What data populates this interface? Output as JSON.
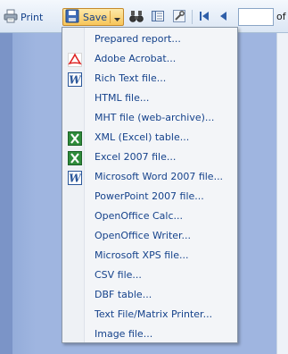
{
  "toolbar": {
    "print_label": "Print",
    "save_label": "Save",
    "page_input_value": "",
    "of_label": "of"
  },
  "menu": {
    "items": [
      {
        "label": "Prepared report...",
        "icon": ""
      },
      {
        "label": "Adobe Acrobat...",
        "icon": "pdf-icon"
      },
      {
        "label": "Rich Text file...",
        "icon": "word-icon"
      },
      {
        "label": "HTML file...",
        "icon": ""
      },
      {
        "label": "MHT file (web-archive)...",
        "icon": ""
      },
      {
        "label": "XML (Excel) table...",
        "icon": "excel-icon"
      },
      {
        "label": "Excel 2007 file...",
        "icon": "excel-icon"
      },
      {
        "label": "Microsoft Word 2007 file...",
        "icon": "word-icon"
      },
      {
        "label": "PowerPoint 2007 file...",
        "icon": ""
      },
      {
        "label": "OpenOffice Calc...",
        "icon": ""
      },
      {
        "label": "OpenOffice Writer...",
        "icon": ""
      },
      {
        "label": "Microsoft XPS file...",
        "icon": ""
      },
      {
        "label": "CSV file...",
        "icon": ""
      },
      {
        "label": "DBF table...",
        "icon": ""
      },
      {
        "label": "Text File/Matrix Printer...",
        "icon": ""
      },
      {
        "label": "Image file...",
        "icon": ""
      }
    ]
  },
  "colors": {
    "accent_text": "#15428b",
    "save_button": "#f7c55a",
    "content_background": "#9fb5e0"
  }
}
